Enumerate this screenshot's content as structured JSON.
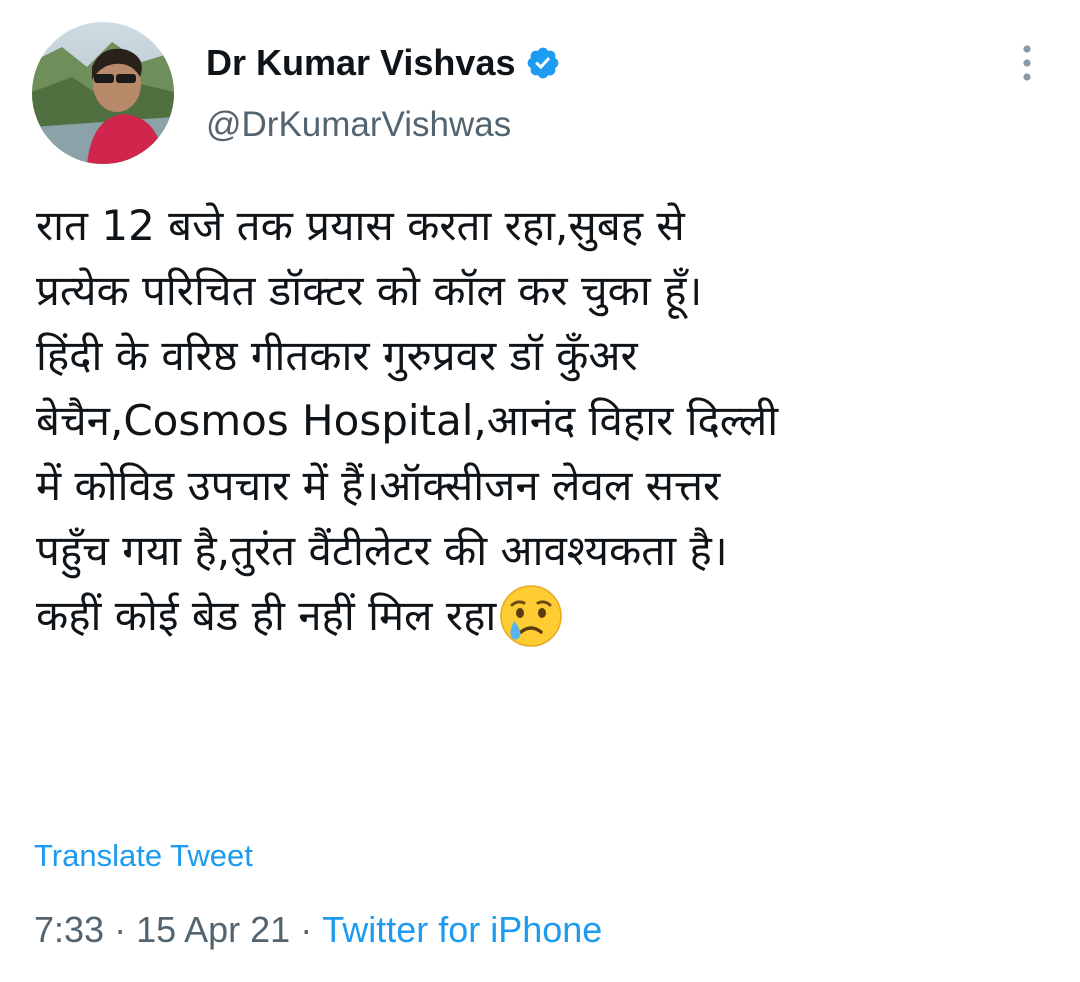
{
  "tweet": {
    "author": {
      "display_name": "Dr Kumar Vishvas",
      "handle": "@DrKumarVishwas",
      "verified": true,
      "avatar_icon": "profile-photo"
    },
    "lines": [
      "रात 12 बजे तक प्रयास करता रहा,सुबह से",
      "प्रत्येक परिचित डॉक्टर को कॉल कर चुका हूँ।",
      "हिंदी के वरिष्ठ गीतकार गुरुप्रवर डॉ कुँअर",
      "बेचैन,Cosmos Hospital,आनंद विहार दिल्ली",
      "में कोविड उपचार में हैं।ऑक्सीजन लेवल सत्तर",
      "पहुँच गया है,तुरंत वैंटीलेटर की आवश्यकता है।",
      "कहीं कोई बेड ही नहीं मिल रहा"
    ],
    "emoji": "crying-face",
    "translate_label": "Translate Tweet",
    "time": "7:33",
    "date": "15 Apr 21",
    "separator": "·",
    "source": "Twitter for iPhone"
  },
  "icons": {
    "verified": "verified-badge-icon",
    "more": "more-vertical-icon"
  },
  "colors": {
    "link": "#1d9bf0",
    "text": "#0f1419",
    "secondary": "#536471",
    "verified": "#1d9bf0"
  }
}
